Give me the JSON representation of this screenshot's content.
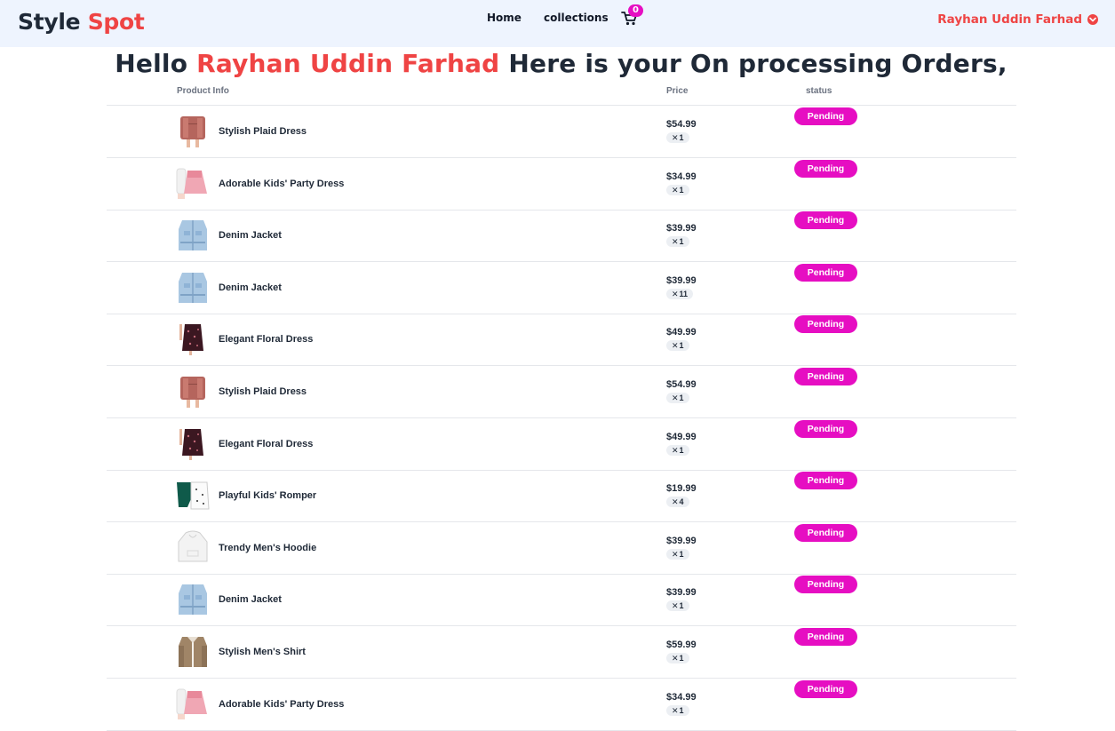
{
  "brand": {
    "part1": "Style",
    "part2": "Spot"
  },
  "nav": {
    "home": "Home",
    "collections": "collections",
    "cart_count": "0",
    "user_name": "Rayhan Uddin Farhad"
  },
  "heading": {
    "prefix": "Hello",
    "name": "Rayhan Uddin Farhad",
    "suffix": "Here is your On processing Orders,"
  },
  "table": {
    "headers": {
      "product": "Product Info",
      "price": "Price",
      "status": "status"
    },
    "rows": [
      {
        "name": "Stylish Plaid Dress",
        "price": "$54.99",
        "qty": "1",
        "status": "Pending",
        "thumb": "plaid-dress"
      },
      {
        "name": "Adorable Kids' Party Dress",
        "price": "$34.99",
        "qty": "1",
        "status": "Pending",
        "thumb": "kids-party-dress"
      },
      {
        "name": "Denim Jacket",
        "price": "$39.99",
        "qty": "1",
        "status": "Pending",
        "thumb": "denim-jacket"
      },
      {
        "name": "Denim Jacket",
        "price": "$39.99",
        "qty": "11",
        "status": "Pending",
        "thumb": "denim-jacket"
      },
      {
        "name": "Elegant Floral Dress",
        "price": "$49.99",
        "qty": "1",
        "status": "Pending",
        "thumb": "floral-dress"
      },
      {
        "name": "Stylish Plaid Dress",
        "price": "$54.99",
        "qty": "1",
        "status": "Pending",
        "thumb": "plaid-dress"
      },
      {
        "name": "Elegant Floral Dress",
        "price": "$49.99",
        "qty": "1",
        "status": "Pending",
        "thumb": "floral-dress"
      },
      {
        "name": "Playful Kids' Romper",
        "price": "$19.99",
        "qty": "4",
        "status": "Pending",
        "thumb": "kids-romper"
      },
      {
        "name": "Trendy Men's Hoodie",
        "price": "$39.99",
        "qty": "1",
        "status": "Pending",
        "thumb": "mens-hoodie"
      },
      {
        "name": "Denim Jacket",
        "price": "$39.99",
        "qty": "1",
        "status": "Pending",
        "thumb": "denim-jacket"
      },
      {
        "name": "Stylish Men's Shirt",
        "price": "$59.99",
        "qty": "1",
        "status": "Pending",
        "thumb": "mens-shirt"
      },
      {
        "name": "Adorable Kids' Party Dress",
        "price": "$34.99",
        "qty": "1",
        "status": "Pending",
        "thumb": "kids-party-dress"
      }
    ]
  },
  "colors": {
    "accent_red": "#ef4444",
    "status_pink": "#e60ec2",
    "navbar_bg": "#eef4fe"
  }
}
